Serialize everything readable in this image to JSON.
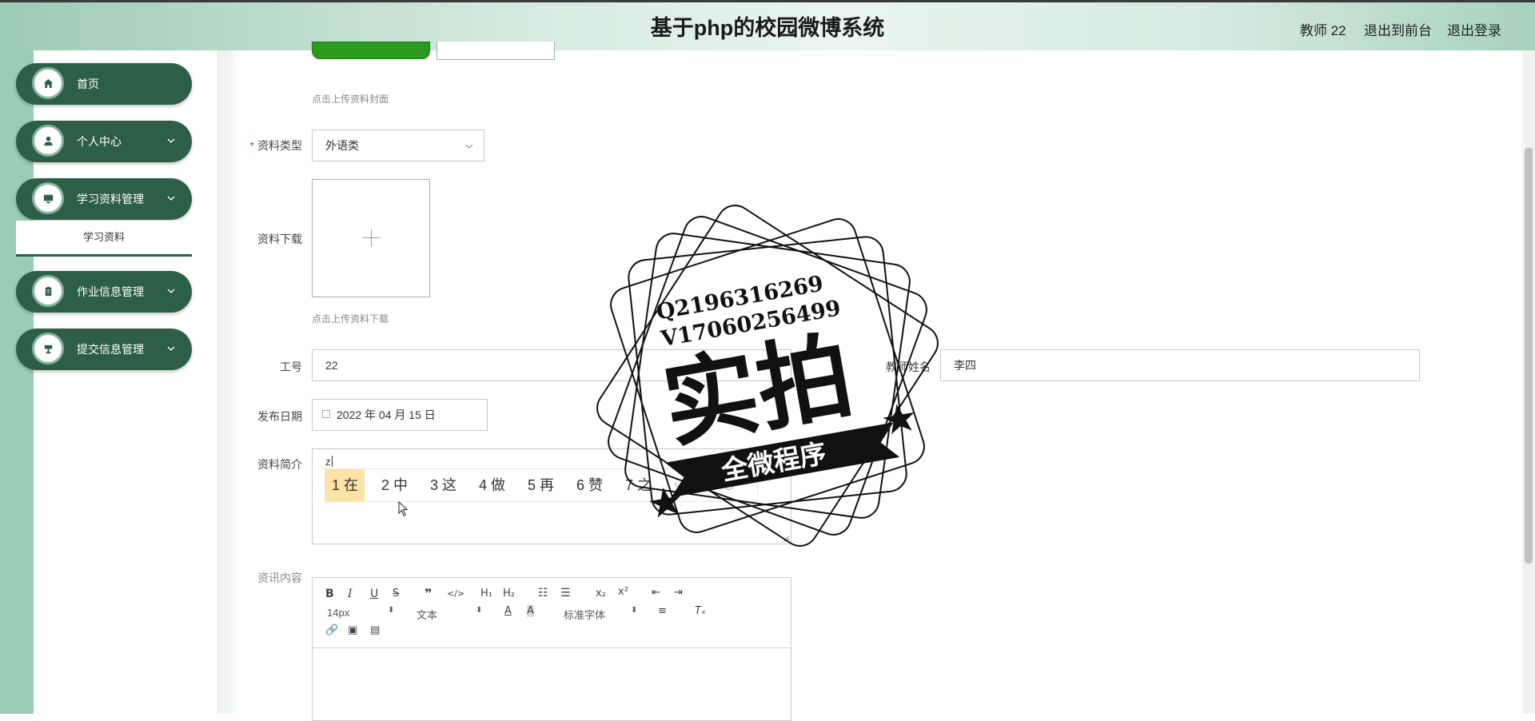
{
  "header": {
    "title": "基于php的校园微博系统",
    "user": "教师 22",
    "front_link": "退出到前台",
    "logout_link": "退出登录"
  },
  "sidebar": {
    "items": [
      {
        "label": "首页",
        "icon": "home-icon"
      },
      {
        "label": "个人中心",
        "icon": "user-icon"
      },
      {
        "label": "学习资料管理",
        "icon": "monitor-icon"
      },
      {
        "label": "作业信息管理",
        "icon": "clipboard-icon"
      },
      {
        "label": "提交信息管理",
        "icon": "upload-icon"
      }
    ],
    "submenu_item": "学习资料"
  },
  "form": {
    "cover_hint": "点击上传资料封面",
    "type_label": "资料类型",
    "type_value": "外语类",
    "download_label": "资料下载",
    "download_hint": "点击上传资料下载",
    "job_no_label": "工号",
    "job_no_value": "22",
    "teacher_name_label": "教师姓名",
    "teacher_name_value": "李四",
    "date_label": "发布日期",
    "date_value": "2022 年 04 月 15 日",
    "intro_label": "资料简介",
    "intro_value": "z",
    "content_label": "资讯内容"
  },
  "ime": {
    "candidates": [
      "1 在",
      "2 中",
      "3 这",
      "4 做",
      "5 再",
      "6 赞",
      "7 之"
    ]
  },
  "editor": {
    "font_size": "14px",
    "paragraph": "文本",
    "font_family": "标准字体"
  },
  "watermark": {
    "line1": "Q2196316269",
    "line2": "V17060256499",
    "big": "实拍",
    "ribbon": "全微程序"
  }
}
